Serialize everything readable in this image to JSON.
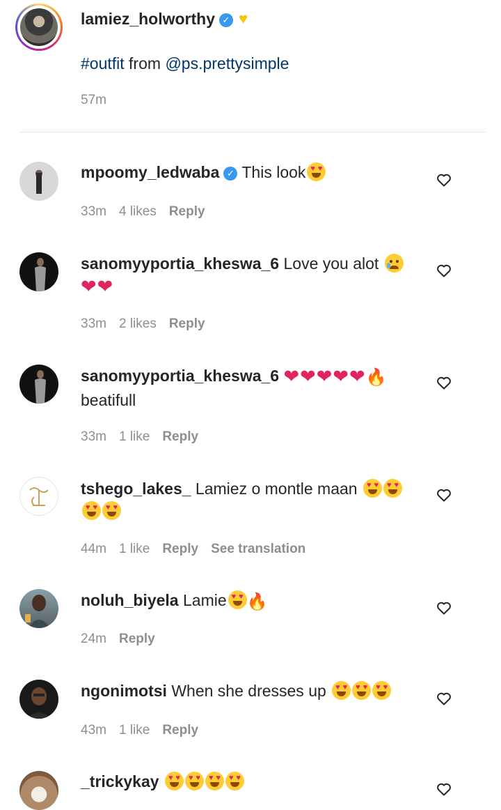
{
  "caption": {
    "username": "lamiez_holworthy",
    "hashtag": "#outfit",
    "text_mid": " from ",
    "mention": "@ps.prettysimple",
    "time": "57m"
  },
  "comments": [
    {
      "username": "mpoomy_ledwaba",
      "text": " This look",
      "time": "33m",
      "likes": "4 likes",
      "reply": "Reply"
    },
    {
      "username": "sanomyyportia_kheswa_6",
      "text": " Love you alot ",
      "time": "33m",
      "likes": "2 likes",
      "reply": "Reply"
    },
    {
      "username": "sanomyyportia_kheswa_6",
      "text": "beatifull",
      "time": "33m",
      "likes": "1 like",
      "reply": "Reply"
    },
    {
      "username": "tshego_lakes_",
      "text": " Lamiez o montle maan ",
      "time": "44m",
      "likes": "1 like",
      "reply": "Reply",
      "translate": "See translation"
    },
    {
      "username": "noluh_biyela",
      "text": " Lamie",
      "time": "24m",
      "reply": "Reply"
    },
    {
      "username": "ngonimotsi",
      "text": " When she dresses up ",
      "time": "43m",
      "likes": "1 like",
      "reply": "Reply"
    },
    {
      "username": "_trickykay",
      "text": " "
    }
  ],
  "icons": {
    "verified": "verified-badge-icon",
    "like": "heart-outline-icon"
  },
  "colors": {
    "link": "#00376b",
    "meta": "#8e8e8e",
    "verified": "#3897f0"
  }
}
